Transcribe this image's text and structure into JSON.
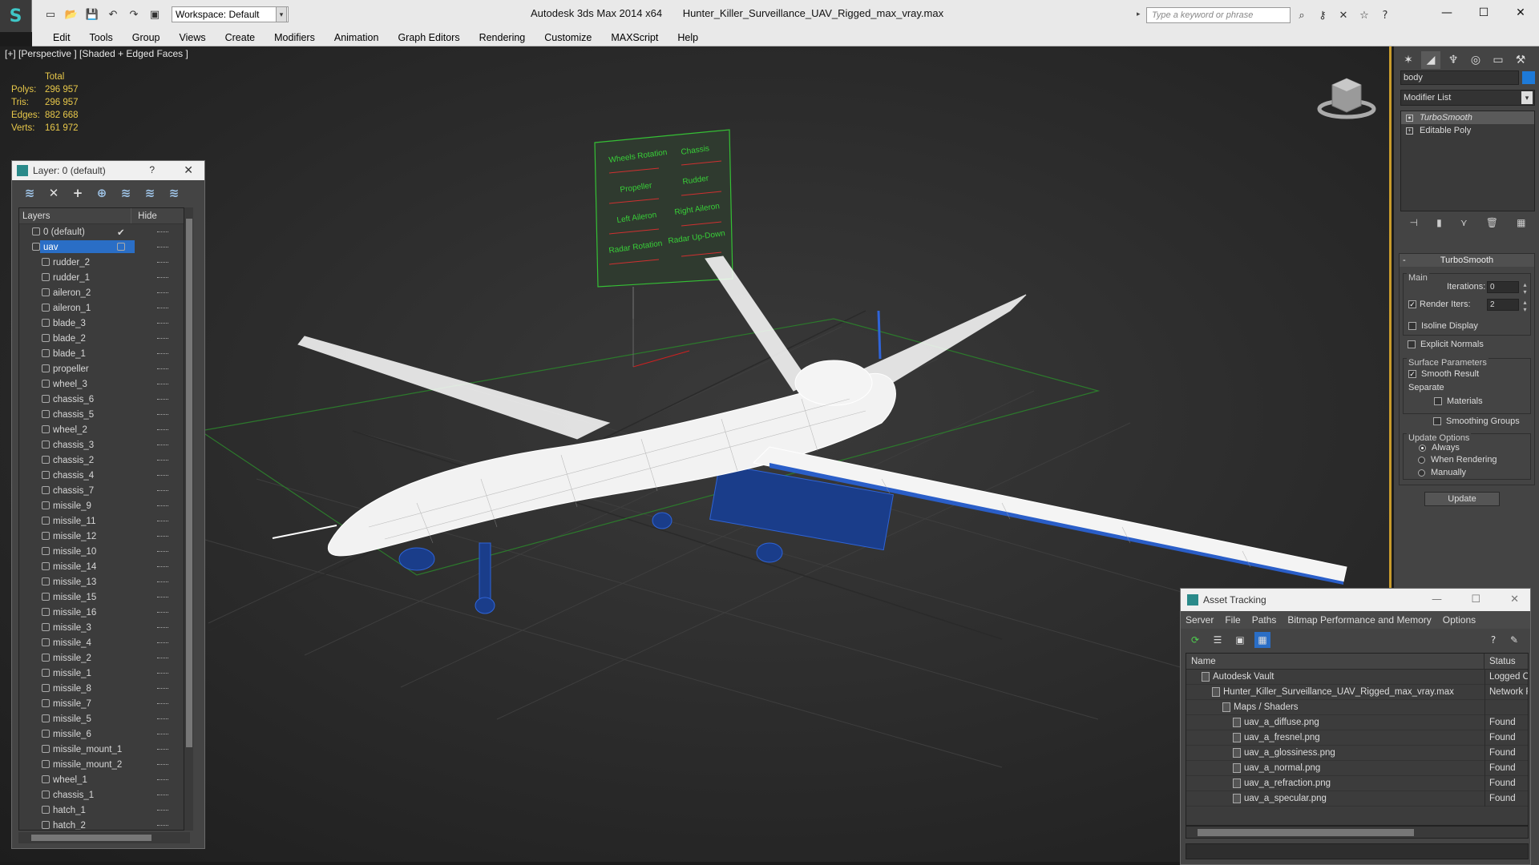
{
  "title_bar": {
    "app_name": "Autodesk 3ds Max  2014 x64",
    "file_name": "Hunter_Killer_Surveillance_UAV_Rigged_max_vray.max",
    "workspace": "Workspace: Default",
    "search_placeholder": "Type a keyword or phrase"
  },
  "menu": [
    "Edit",
    "Tools",
    "Group",
    "Views",
    "Create",
    "Modifiers",
    "Animation",
    "Graph Editors",
    "Rendering",
    "Customize",
    "MAXScript",
    "Help"
  ],
  "viewport": {
    "label": "[+] [Perspective ] [Shaded + Edged Faces ]",
    "stats": {
      "total_label": "Total",
      "rows": [
        {
          "key": "Polys:",
          "value": "296 957"
        },
        {
          "key": "Tris:",
          "value": "296 957"
        },
        {
          "key": "Edges:",
          "value": "882 668"
        },
        {
          "key": "Verts:",
          "value": "161 972"
        }
      ]
    },
    "rig_panel_labels": [
      "Wheels Rotation",
      "Chassis",
      "Propeller",
      "Rudder",
      "Left Aileron",
      "Right Aileron",
      "Radar Rotation",
      "Radar Up-Down"
    ]
  },
  "layer_panel": {
    "title": "Layer: 0 (default)",
    "help": "?",
    "col_layers": "Layers",
    "col_hide": "Hide",
    "layers": [
      {
        "name": "0 (default)",
        "level": 0,
        "active": true
      },
      {
        "name": "uav",
        "level": 0,
        "selected": true
      },
      {
        "name": "rudder_2",
        "level": 1
      },
      {
        "name": "rudder_1",
        "level": 1
      },
      {
        "name": "aileron_2",
        "level": 1
      },
      {
        "name": "aileron_1",
        "level": 1
      },
      {
        "name": "blade_3",
        "level": 1
      },
      {
        "name": "blade_2",
        "level": 1
      },
      {
        "name": "blade_1",
        "level": 1
      },
      {
        "name": "propeller",
        "level": 1
      },
      {
        "name": "wheel_3",
        "level": 1
      },
      {
        "name": "chassis_6",
        "level": 1
      },
      {
        "name": "chassis_5",
        "level": 1
      },
      {
        "name": "wheel_2",
        "level": 1
      },
      {
        "name": "chassis_3",
        "level": 1
      },
      {
        "name": "chassis_2",
        "level": 1
      },
      {
        "name": "chassis_4",
        "level": 1
      },
      {
        "name": "chassis_7",
        "level": 1
      },
      {
        "name": "missile_9",
        "level": 1
      },
      {
        "name": "missile_11",
        "level": 1
      },
      {
        "name": "missile_12",
        "level": 1
      },
      {
        "name": "missile_10",
        "level": 1
      },
      {
        "name": "missile_14",
        "level": 1
      },
      {
        "name": "missile_13",
        "level": 1
      },
      {
        "name": "missile_15",
        "level": 1
      },
      {
        "name": "missile_16",
        "level": 1
      },
      {
        "name": "missile_3",
        "level": 1
      },
      {
        "name": "missile_4",
        "level": 1
      },
      {
        "name": "missile_2",
        "level": 1
      },
      {
        "name": "missile_1",
        "level": 1
      },
      {
        "name": "missile_8",
        "level": 1
      },
      {
        "name": "missile_7",
        "level": 1
      },
      {
        "name": "missile_5",
        "level": 1
      },
      {
        "name": "missile_6",
        "level": 1
      },
      {
        "name": "missile_mount_1",
        "level": 1
      },
      {
        "name": "missile_mount_2",
        "level": 1
      },
      {
        "name": "wheel_1",
        "level": 1
      },
      {
        "name": "chassis_1",
        "level": 1
      },
      {
        "name": "hatch_1",
        "level": 1
      },
      {
        "name": "hatch_2",
        "level": 1
      }
    ]
  },
  "command_panel": {
    "object_name": "body",
    "object_color": "#1e7ad8",
    "modifier_list": "Modifier List",
    "stack": [
      {
        "label": "TurboSmooth",
        "active": true
      },
      {
        "label": "Editable Poly",
        "active": false
      }
    ],
    "turbosmooth": {
      "header": "TurboSmooth",
      "main_label": "Main",
      "iterations_label": "Iterations:",
      "iterations_value": "0",
      "render_iters_label": "Render Iters:",
      "render_iters_value": "2",
      "isoline_label": "Isoline Display",
      "explicit_normals_label": "Explicit Normals",
      "surface_params_label": "Surface Parameters",
      "smooth_result_label": "Smooth Result",
      "separate_label": "Separate",
      "materials_label": "Materials",
      "smoothing_groups_label": "Smoothing Groups",
      "update_options_label": "Update Options",
      "always_label": "Always",
      "when_rendering_label": "When Rendering",
      "manually_label": "Manually",
      "update_button": "Update"
    }
  },
  "asset_tracking": {
    "title": "Asset Tracking",
    "menu": [
      "Server",
      "File",
      "Paths",
      "Bitmap Performance and Memory",
      "Options"
    ],
    "col_name": "Name",
    "col_status": "Status",
    "rows": [
      {
        "name": "Autodesk Vault",
        "status": "Logged O",
        "indent": 1
      },
      {
        "name": "Hunter_Killer_Surveillance_UAV_Rigged_max_vray.max",
        "status": "Network F",
        "indent": 2
      },
      {
        "name": "Maps / Shaders",
        "status": "",
        "indent": 3
      },
      {
        "name": "uav_a_diffuse.png",
        "status": "Found",
        "indent": 4
      },
      {
        "name": "uav_a_fresnel.png",
        "status": "Found",
        "indent": 4
      },
      {
        "name": "uav_a_glossiness.png",
        "status": "Found",
        "indent": 4
      },
      {
        "name": "uav_a_normal.png",
        "status": "Found",
        "indent": 4
      },
      {
        "name": "uav_a_refraction.png",
        "status": "Found",
        "indent": 4
      },
      {
        "name": "uav_a_specular.png",
        "status": "Found",
        "indent": 4
      }
    ]
  }
}
